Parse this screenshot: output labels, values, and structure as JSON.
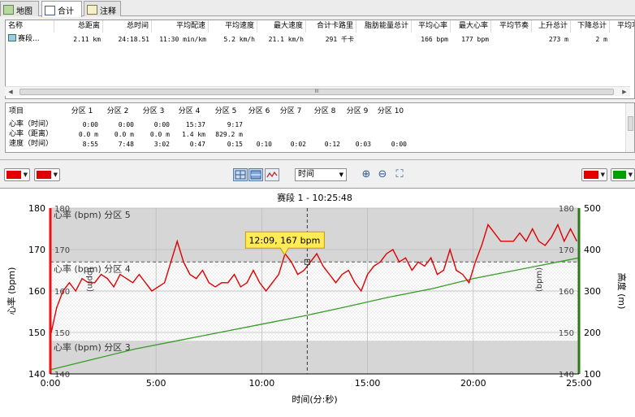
{
  "tabs": [
    {
      "label": "地图",
      "icon": "map-icon"
    },
    {
      "label": "合计",
      "icon": "table-icon"
    },
    {
      "label": "注释",
      "icon": "notes-icon"
    }
  ],
  "summary": {
    "columns": [
      "名称",
      "总距离",
      "总时间",
      "平均配速",
      "平均速度",
      "最大速度",
      "合计卡路里",
      "脂肪能量总计",
      "平均心率",
      "最大心率",
      "平均节奏",
      "上升总计",
      "下降总计",
      "平均功"
    ],
    "row": [
      "赛段...",
      "2.11 km",
      "24:18.51",
      "11:30 min/km",
      "5.2 km/h",
      "21.1 km/h",
      "291 千卡",
      "",
      "166 bpm",
      "177 bpm",
      "",
      "273 m",
      "2 m",
      ""
    ],
    "scroll_grip": "III"
  },
  "zones": {
    "header": [
      "项目",
      "分区 1",
      "分区 2",
      "分区 3",
      "分区 4",
      "分区 5",
      "分区 6",
      "分区 7",
      "分区 8",
      "分区 9",
      "分区 10"
    ],
    "rows": [
      [
        "心率（时间）",
        "0:00",
        "0:00",
        "0:00",
        "15:37",
        "9:17",
        "",
        "",
        "",
        "",
        ""
      ],
      [
        "心率（距离）",
        "0.0 m",
        "0.0 m",
        "0.0 m",
        "1.4 km",
        "829.2 m",
        "",
        "",
        "",
        "",
        ""
      ],
      [
        "速度（时间）",
        "8:55",
        "7:48",
        "3:02",
        "0:47",
        "0:15",
        "0:10",
        "0:02",
        "0:12",
        "0:03",
        "0:00"
      ]
    ]
  },
  "toolbar": {
    "left_color_1": "#e00000",
    "left_color_2": "#e00000",
    "right_color_1": "#e00000",
    "right_color_2": "#00a000",
    "axis_select": "时间"
  },
  "chart_data": {
    "type": "line",
    "title": "赛段 1 - 10:25:48",
    "xlabel": "时间(分:秒)",
    "ylabel_left": "心率 (bpm)",
    "ylabel_right": "高度 (m)",
    "xlim": [
      0,
      25
    ],
    "ylim_left": [
      140,
      180
    ],
    "ylim_right": [
      100,
      500
    ],
    "x_ticks": [
      "0:00",
      "5:00",
      "10:00",
      "15:00",
      "20:00",
      "25:00"
    ],
    "y_ticks_left": [
      140,
      150,
      160,
      170,
      180
    ],
    "y_ticks_right": [
      100,
      200,
      300,
      400,
      500
    ],
    "zones": [
      {
        "label": "心率 (bpm) 分区 5",
        "from": 167,
        "to": 180
      },
      {
        "label": "心率 (bpm) 分区 4",
        "from": 148,
        "to": 167
      },
      {
        "label": "心率 (bpm) 分区 3",
        "from": 140,
        "to": 148
      }
    ],
    "threshold_line": 167,
    "cursor": {
      "x": 12.15,
      "y": 167,
      "label": "12:09, 167 bpm"
    },
    "inner_axis_labels": [
      "(bpm)",
      "(bpm)"
    ],
    "series": [
      {
        "name": "心率",
        "color": "#dd0000",
        "x": [
          0.0,
          0.3,
          0.6,
          0.9,
          1.2,
          1.5,
          1.8,
          2.1,
          2.4,
          2.7,
          3.0,
          3.3,
          3.6,
          3.9,
          4.2,
          4.5,
          4.8,
          5.1,
          5.4,
          5.7,
          6.0,
          6.3,
          6.6,
          6.9,
          7.2,
          7.5,
          7.8,
          8.1,
          8.4,
          8.7,
          9.0,
          9.3,
          9.6,
          9.9,
          10.2,
          10.5,
          10.8,
          11.1,
          11.4,
          11.7,
          12.0,
          12.3,
          12.6,
          12.9,
          13.2,
          13.5,
          13.8,
          14.1,
          14.4,
          14.7,
          15.0,
          15.3,
          15.6,
          15.9,
          16.2,
          16.5,
          16.8,
          17.1,
          17.4,
          17.7,
          18.0,
          18.3,
          18.6,
          18.9,
          19.2,
          19.5,
          19.8,
          20.1,
          20.4,
          20.7,
          21.0,
          21.3,
          21.6,
          21.9,
          22.2,
          22.5,
          22.8,
          23.1,
          23.4,
          23.7,
          24.0,
          24.3,
          24.6,
          24.9
        ],
        "y": [
          149,
          156,
          160,
          162,
          160,
          163,
          162,
          162,
          164,
          163,
          161,
          164,
          163,
          162,
          164,
          162,
          160,
          161,
          162,
          167,
          172,
          167,
          164,
          163,
          165,
          162,
          161,
          162,
          162,
          164,
          161,
          162,
          165,
          162,
          160,
          162,
          164,
          169,
          167,
          164,
          165,
          167,
          169,
          166,
          164,
          162,
          164,
          165,
          162,
          160,
          164,
          166,
          167,
          169,
          170,
          167,
          168,
          165,
          167,
          166,
          168,
          164,
          165,
          170,
          165,
          164,
          162,
          167,
          171,
          176,
          174,
          172,
          172,
          172,
          174,
          172,
          175,
          172,
          171,
          173,
          176,
          172,
          175,
          172
        ]
      },
      {
        "name": "高度",
        "color": "#3a9a2a",
        "x": [
          0,
          2,
          4,
          6,
          8,
          10,
          12,
          14,
          16,
          18,
          20,
          22,
          24,
          25
        ],
        "y": [
          110,
          135,
          160,
          180,
          200,
          220,
          240,
          262,
          285,
          305,
          330,
          350,
          370,
          380
        ]
      }
    ]
  }
}
